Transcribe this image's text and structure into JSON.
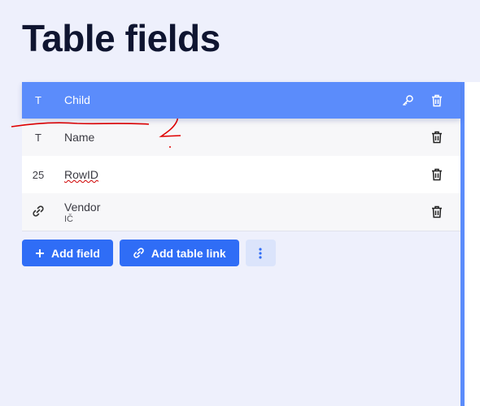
{
  "page": {
    "title": "Table fields"
  },
  "fields": [
    {
      "type_glyph": "T",
      "name": "Child",
      "sub": "",
      "editing": true
    },
    {
      "type_glyph": "T",
      "name": "Name",
      "sub": ""
    },
    {
      "type_glyph": "25",
      "name": "RowID",
      "sub": ""
    },
    {
      "type_glyph": "link-icon",
      "name": "Vendor",
      "sub": "IČ"
    }
  ],
  "actions": {
    "add_field_label": "Add field",
    "add_table_link_label": "Add table link"
  },
  "colors": {
    "accent": "#2f6df6",
    "editing_row": "#5b8cfb",
    "annotation": "#e00000"
  },
  "annotation_text": "2"
}
